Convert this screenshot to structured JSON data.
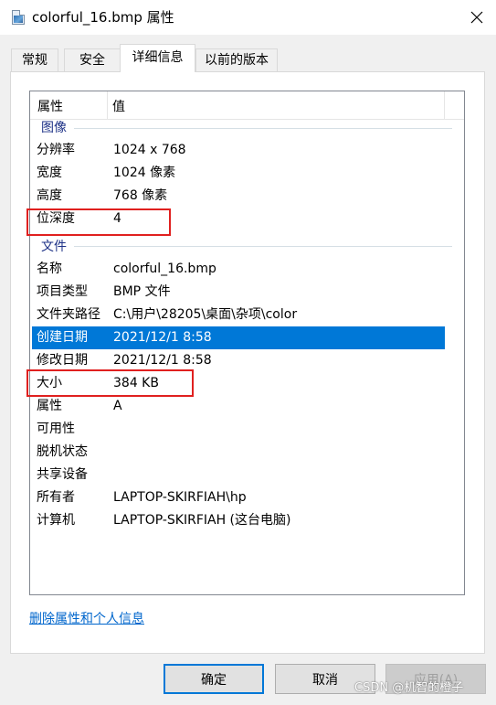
{
  "window": {
    "title": "colorful_16.bmp 属性",
    "close_glyph": "×"
  },
  "tabs": [
    {
      "label": "常规"
    },
    {
      "label": "安全"
    },
    {
      "label": "详细信息",
      "active": true
    },
    {
      "label": "以前的版本"
    }
  ],
  "list": {
    "columns": [
      "属性",
      "值"
    ],
    "groups": {
      "image": "图像",
      "file": "文件"
    },
    "image_rows": [
      {
        "key": "分辨率",
        "value": "1024 x 768"
      },
      {
        "key": "宽度",
        "value": "1024 像素"
      },
      {
        "key": "高度",
        "value": "768 像素"
      },
      {
        "key": "位深度",
        "value": "4"
      }
    ],
    "file_rows": [
      {
        "key": "名称",
        "value": "colorful_16.bmp"
      },
      {
        "key": "项目类型",
        "value": "BMP 文件"
      },
      {
        "key": "文件夹路径",
        "value": "C:\\用户\\28205\\桌面\\杂项\\color"
      },
      {
        "key": "创建日期",
        "value": "2021/12/1 8:58",
        "selected": true
      },
      {
        "key": "修改日期",
        "value": "2021/12/1 8:58"
      },
      {
        "key": "大小",
        "value": "384 KB"
      },
      {
        "key": "属性",
        "value": "A"
      },
      {
        "key": "可用性",
        "value": ""
      },
      {
        "key": "脱机状态",
        "value": ""
      },
      {
        "key": "共享设备",
        "value": ""
      },
      {
        "key": "所有者",
        "value": "LAPTOP-SKIRFIAH\\hp"
      },
      {
        "key": "计算机",
        "value": "LAPTOP-SKIRFIAH (这台电脑)"
      }
    ]
  },
  "remove_link": "删除属性和个人信息",
  "buttons": {
    "ok": "确定",
    "cancel": "取消",
    "apply": "应用(A)"
  },
  "watermark": "CSDN @机智的橙子",
  "colors": {
    "selection": "#0078d7",
    "annotation": "#e0201f",
    "group_text": "#1e3287",
    "link": "#0066cc"
  }
}
